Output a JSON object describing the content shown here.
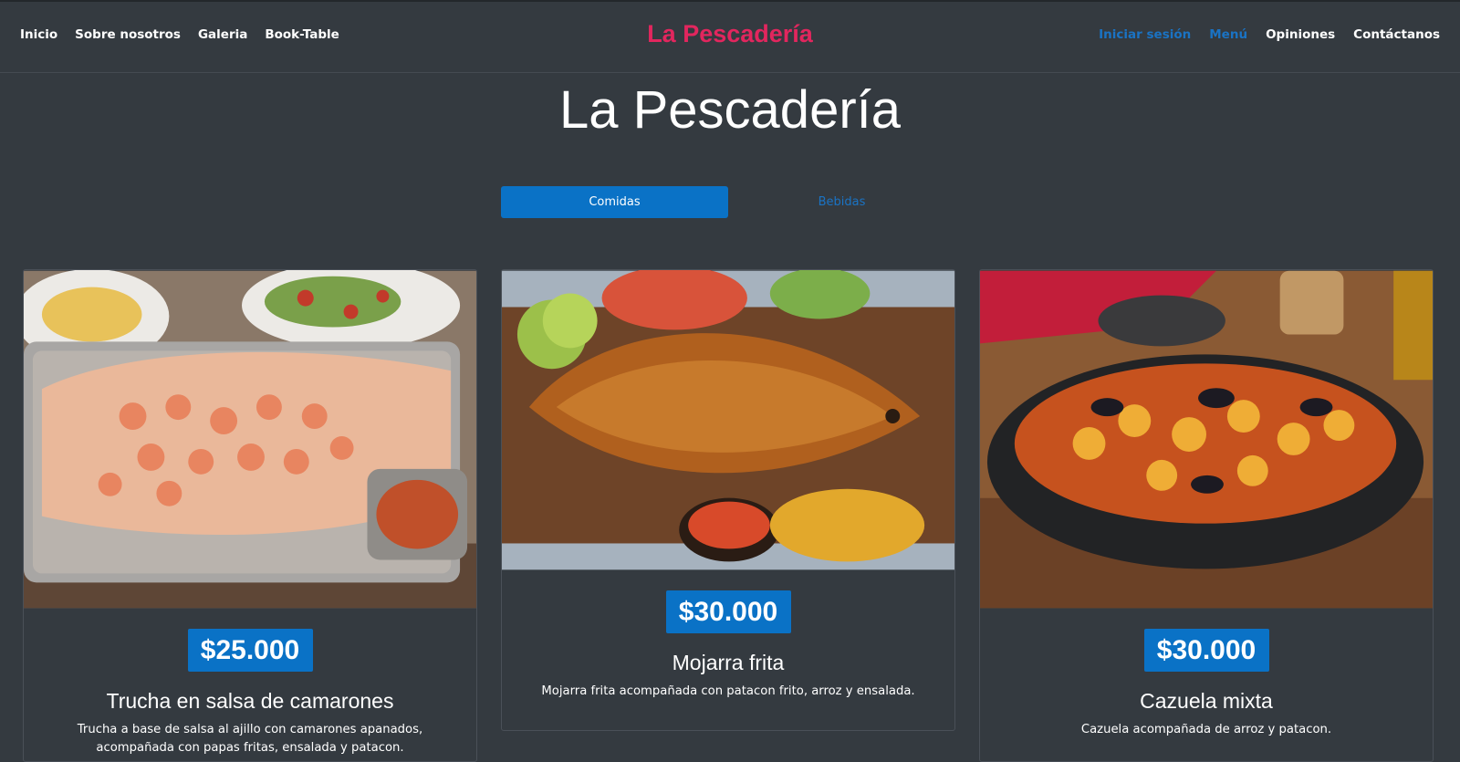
{
  "nav": {
    "brand": "La Pescadería",
    "left": [
      "Inicio",
      "Sobre nosotros",
      "Galeria",
      "Book-Table"
    ],
    "right": [
      "Iniciar sesión",
      "Menú",
      "Opiniones",
      "Contáctanos"
    ]
  },
  "hero": {
    "title": "La Pescadería"
  },
  "tabs": [
    {
      "label": "Comidas",
      "active": true
    },
    {
      "label": "Bebidas",
      "active": false
    }
  ],
  "menu": [
    {
      "price": "$25.000",
      "name": "Trucha en salsa de camarones",
      "description": "Trucha a base de salsa al ajillo con camarones apanados, acompañada con papas fritas, ensalada y patacon.",
      "image": "trout-shrimp-platter"
    },
    {
      "price": "$30.000",
      "name": "Mojarra frita",
      "description": "Mojarra frita acompañada con patacon frito, arroz y ensalada.",
      "image": "fried-tilapia"
    },
    {
      "price": "$30.000",
      "name": "Cazuela mixta",
      "description": "Cazuela acompañada de arroz y patacon.",
      "image": "seafood-casserole"
    }
  ],
  "colors": {
    "background": "#343a40",
    "brand": "#e2265e",
    "accent": "#0a72c6",
    "link_blue": "#1a73c4"
  }
}
